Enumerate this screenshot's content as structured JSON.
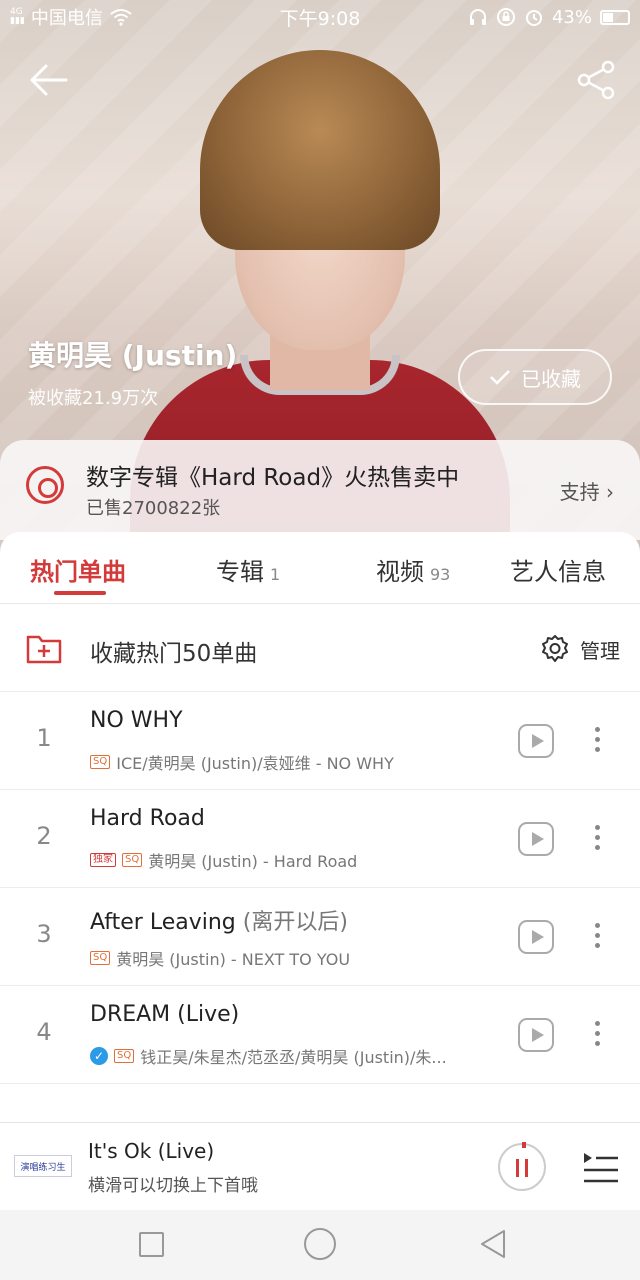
{
  "status_bar": {
    "carrier": "中国电信",
    "time": "下午9:08",
    "battery": "43%",
    "battery_level": 0.43
  },
  "header": {
    "artist_name": "黄明昊 (Justin)",
    "favorite_count": "被收藏21.9万次",
    "collected_label": "已收藏"
  },
  "promo": {
    "title": "数字专辑《Hard Road》火热售卖中",
    "sold": "已售2700822张",
    "support_label": "支持"
  },
  "tabs": [
    {
      "label": "热门单曲",
      "count": ""
    },
    {
      "label": "专辑",
      "count": "1"
    },
    {
      "label": "视频",
      "count": "93"
    },
    {
      "label": "艺人信息",
      "count": ""
    }
  ],
  "collect_row": {
    "label": "收藏热门50单曲",
    "manage_label": "管理"
  },
  "songs": [
    {
      "num": "1",
      "title": "NO WHY",
      "title_alt": "",
      "badges": [
        "SQ"
      ],
      "meta": "ICE/黄明昊 (Justin)/袁娅维 - NO WHY"
    },
    {
      "num": "2",
      "title": "Hard Road",
      "title_alt": "",
      "badges": [
        "独家",
        "SQ"
      ],
      "meta": "黄明昊 (Justin) - Hard Road"
    },
    {
      "num": "3",
      "title": "After Leaving",
      "title_alt": "(离开以后)",
      "badges": [
        "SQ"
      ],
      "meta": "黄明昊 (Justin) - NEXT TO YOU"
    },
    {
      "num": "4",
      "title": "DREAM (Live)",
      "title_alt": "",
      "badges": [
        "SQ"
      ],
      "meta": "钱正昊/朱星杰/范丞丞/黄明昊 (Justin)/朱..."
    }
  ],
  "player": {
    "title": "It's Ok (Live)",
    "subtitle": "横滑可以切换上下首哦",
    "cover_text": "演唱练习生"
  },
  "icons": {
    "back": "arrow-left-icon",
    "share": "share-icon",
    "check": "check-icon",
    "disc": "disc-icon",
    "folder_add": "folder-plus-icon",
    "gear": "gear-icon",
    "play": "play-icon",
    "more": "more-vertical-icon",
    "pause": "pause-icon",
    "queue": "playlist-icon"
  },
  "colors": {
    "accent": "#d33a3a",
    "sq_badge": "#e0703a",
    "verified": "#2b9be8"
  }
}
